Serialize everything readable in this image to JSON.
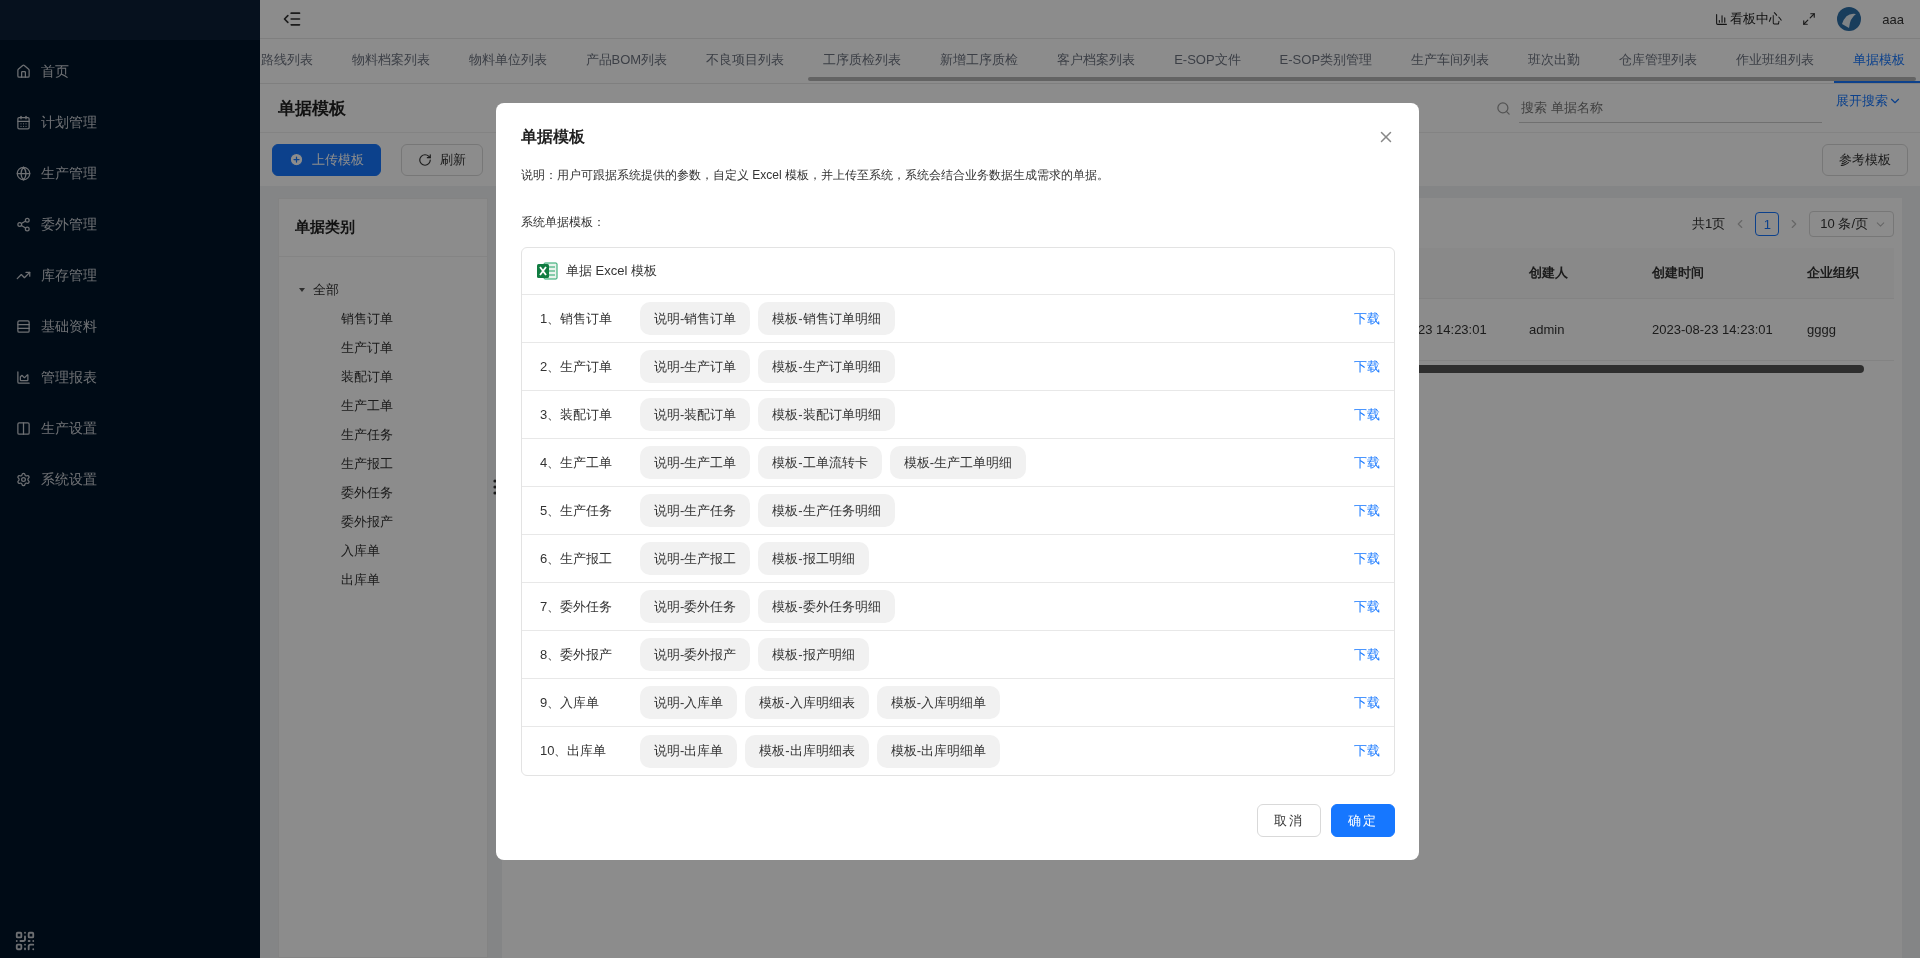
{
  "sidebar": {
    "items": [
      {
        "label": "首页",
        "selected": false
      },
      {
        "label": "计划管理",
        "selected": false
      },
      {
        "label": "生产管理",
        "selected": false
      },
      {
        "label": "委外管理",
        "selected": false
      },
      {
        "label": "库存管理",
        "selected": false
      },
      {
        "label": "基础资料",
        "selected": false
      },
      {
        "label": "管理报表",
        "selected": false
      },
      {
        "label": "生产设置",
        "selected": false
      },
      {
        "label": "系统设置",
        "selected": false
      }
    ]
  },
  "topbar": {
    "dashboard_link": "看板中心",
    "username": "aaa"
  },
  "tabs": [
    {
      "label": "路线列表",
      "selected": false
    },
    {
      "label": "物料档案列表",
      "selected": false
    },
    {
      "label": "物料单位列表",
      "selected": false
    },
    {
      "label": "产品BOM列表",
      "selected": false
    },
    {
      "label": "不良项目列表",
      "selected": false
    },
    {
      "label": "工序质检列表",
      "selected": false
    },
    {
      "label": "新增工序质检",
      "selected": false
    },
    {
      "label": "客户档案列表",
      "selected": false
    },
    {
      "label": "E-SOP文件",
      "selected": false
    },
    {
      "label": "E-SOP类别管理",
      "selected": false
    },
    {
      "label": "生产车间列表",
      "selected": false
    },
    {
      "label": "班次出勤",
      "selected": false
    },
    {
      "label": "仓库管理列表",
      "selected": false
    },
    {
      "label": "作业班组列表",
      "selected": false
    },
    {
      "label": "单据模板",
      "selected": true
    }
  ],
  "page": {
    "title": "单据模板",
    "search": {
      "placeholder": "搜索 单据名称"
    },
    "expand_search": "展开搜索",
    "upload_button": "上传模板",
    "refresh_button": "刷新",
    "reference_button": "参考模板"
  },
  "category_panel": {
    "title": "单据类别",
    "tree": [
      {
        "label": "全部",
        "expanded": true,
        "children": [
          {
            "label": "销售订单"
          },
          {
            "label": "生产订单"
          },
          {
            "label": "装配订单"
          },
          {
            "label": "生产工单"
          },
          {
            "label": "生产任务"
          },
          {
            "label": "生产报工"
          },
          {
            "label": "委外任务"
          },
          {
            "label": "委外报产"
          },
          {
            "label": "入库单"
          },
          {
            "label": "出库单"
          }
        ]
      }
    ]
  },
  "pagination": {
    "total": "共1页",
    "pages": [
      {
        "label": "1",
        "selected": true
      }
    ],
    "page_size": "10 条/页"
  },
  "table": {
    "columns": [
      "创建人",
      "创建时间",
      "企业组织"
    ],
    "rows": [
      {
        "partial_cell": "23 14:23:01",
        "cells": [
          "admin",
          "2023-08-23 14:23:01",
          "gggg"
        ]
      }
    ]
  },
  "dialog": {
    "title": "单据模板",
    "description": "说明：用户可跟据系统提供的参数，自定义 Excel 模板，并上传至系统，系统会结合业务数据生成需求的单据。",
    "section_label": "系统单据模板：",
    "list_header": "单据 Excel 模板",
    "rows": [
      {
        "label": "1、销售订单",
        "files": [
          "说明-销售订单",
          "模板-销售订单明细"
        ],
        "action": "下载"
      },
      {
        "label": "2、生产订单",
        "files": [
          "说明-生产订单",
          "模板-生产订单明细"
        ],
        "action": "下载"
      },
      {
        "label": "3、装配订单",
        "files": [
          "说明-装配订单",
          "模板-装配订单明细"
        ],
        "action": "下载"
      },
      {
        "label": "4、生产工单",
        "files": [
          "说明-生产工单",
          "模板-工单流转卡",
          "模板-生产工单明细"
        ],
        "action": "下载"
      },
      {
        "label": "5、生产任务",
        "files": [
          "说明-生产任务",
          "模板-生产任务明细"
        ],
        "action": "下载"
      },
      {
        "label": "6、生产报工",
        "files": [
          "说明-生产报工",
          "模板-报工明细"
        ],
        "action": "下载"
      },
      {
        "label": "7、委外任务",
        "files": [
          "说明-委外任务",
          "模板-委外任务明细"
        ],
        "action": "下载"
      },
      {
        "label": "8、委外报产",
        "files": [
          "说明-委外报产",
          "模板-报产明细"
        ],
        "action": "下载"
      },
      {
        "label": "9、入库单",
        "files": [
          "说明-入库单",
          "模板-入库明细表",
          "模板-入库明细单"
        ],
        "action": "下载"
      },
      {
        "label": "10、出库单",
        "files": [
          "说明-出库单",
          "模板-出库明细表",
          "模板-出库明细单"
        ],
        "action": "下载"
      }
    ],
    "buttons": [
      {
        "label": "取消",
        "kind": "default"
      },
      {
        "label": "确定",
        "kind": "primary"
      }
    ]
  }
}
